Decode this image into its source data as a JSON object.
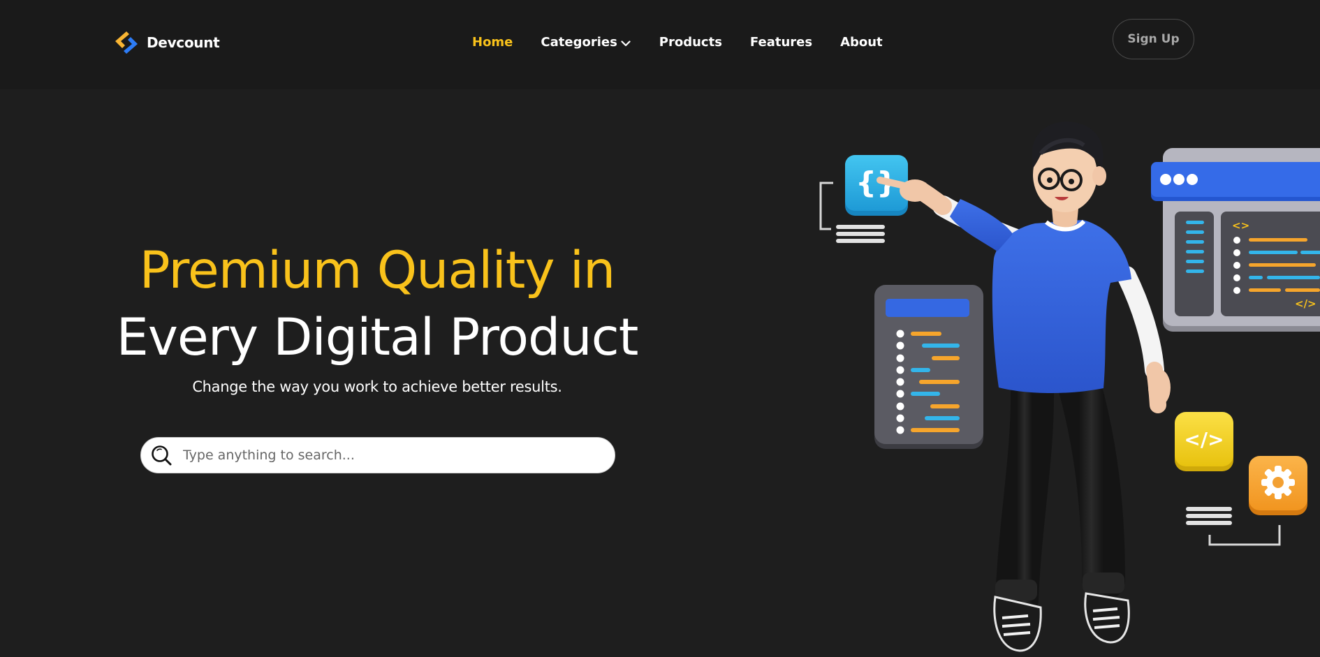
{
  "header": {
    "logo": {
      "name": "Devcount"
    },
    "nav": [
      {
        "label": "Home",
        "active": true
      },
      {
        "label": "Categories",
        "has_dropdown": true
      },
      {
        "label": "Products"
      },
      {
        "label": "Features"
      },
      {
        "label": "About"
      }
    ],
    "signup_label": "Sign Up"
  },
  "hero": {
    "title_line1": "Premium Quality in",
    "title_line2": "Every Digital Product",
    "subtitle": "Change the way you work to achieve better results.",
    "search": {
      "placeholder": "Type anything to search..."
    }
  },
  "icons": {
    "logo": "logo-mark-icon",
    "dropdown": "chevron-down-icon",
    "search": "search-icon",
    "illustration": [
      "curly-braces-icon",
      "code-tag-icon",
      "gear-icon",
      "browser-window",
      "code-list-card"
    ]
  },
  "colors": {
    "background": "#1e1e1e",
    "header": "#1a1a1a",
    "accent": "#f9c21b",
    "text": "#ffffff",
    "brand_blue": "#2d7cf6"
  }
}
